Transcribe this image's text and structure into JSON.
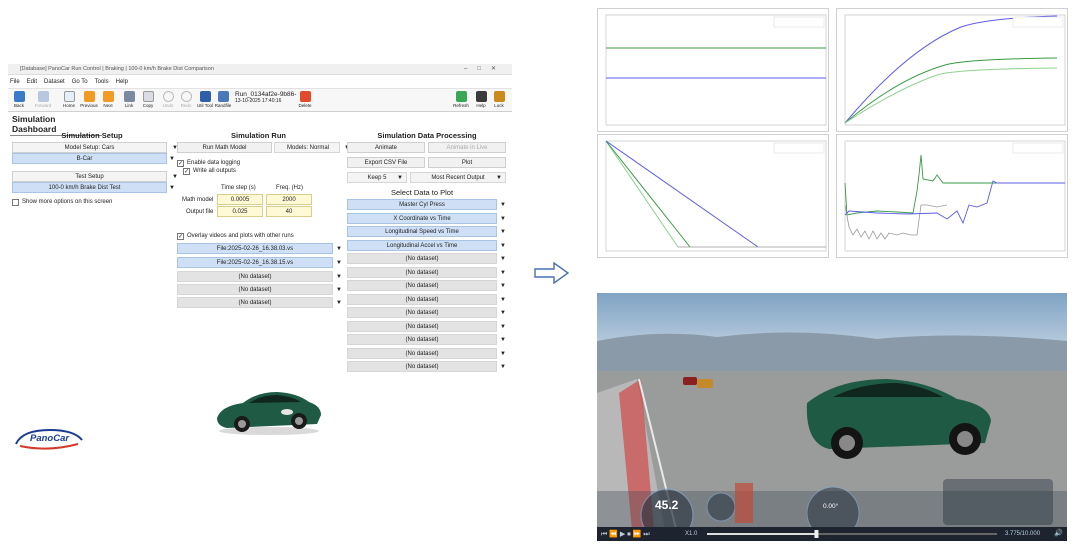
{
  "window": {
    "title": "[Database] PanoCar Run Control | Braking | 100-0 km/h Brake Dist Comparison",
    "menu": [
      "File",
      "Edit",
      "Dataset",
      "Go To",
      "Tools",
      "Help"
    ],
    "toolbar": {
      "back": "Back",
      "forward": "Forward",
      "home": "Home",
      "previous": "Previous",
      "next": "Next",
      "link": "Link",
      "copy": "Copy",
      "undo": "Undo",
      "redo": "Redo",
      "util_tool": "Util Tool",
      "randfile": "Randfile",
      "delete": "Delete",
      "refresh": "Refresh",
      "help": "Help",
      "lock": "Lock"
    },
    "run_name": "Run_0134af2e-9b86-",
    "run_time": "13-10-2025 17:40:16"
  },
  "dashboard": {
    "title": "Simulation Dashboard",
    "setup": {
      "heading": "Simulation Setup",
      "model_setup": "Model Setup: Cars",
      "vehicle": "B-Car",
      "test_setup": "Test Setup",
      "test": "100-0 km/h Brake Dist Test",
      "more_options": "Show more options on this screen"
    },
    "run": {
      "heading": "Simulation Run",
      "run_math": "Run Math Model",
      "models": "Models: Normal",
      "enable_logging": "Enable data logging",
      "write_outputs": "Write all outputs",
      "col_timestep": "Time step (s)",
      "col_freq": "Freq. (Hz)",
      "math_model_label": "Math model",
      "math_timestep": "0.0005",
      "math_freq": "2000",
      "output_file_label": "Output file",
      "output_timestep": "0.025",
      "output_freq": "40",
      "overlay": "Overlay videos and plots with other runs",
      "overlay_files": [
        "File:2025-02-26_16.38.03.vs",
        "File:2025-02-26_16.38.15.vs",
        "(No dataset)",
        "(No dataset)",
        "(No dataset)"
      ]
    },
    "processing": {
      "heading": "Simulation Data Processing",
      "animate": "Animate",
      "animate_live": "Animate in Live",
      "export_csv": "Export CSV File",
      "plot": "Plot",
      "keep": "Keep 5",
      "recent": "Most Recent Output",
      "select_heading": "Select Data to Plot",
      "plot_items": [
        "Master Cyl Press",
        "X Coordinate vs Time",
        "Longitudinal Speed vs Time",
        "Longitudinal Accel vs Time",
        "(No dataset)",
        "(No dataset)",
        "(No dataset)",
        "(No dataset)",
        "(No dataset)",
        "(No dataset)",
        "(No dataset)",
        "(No dataset)",
        "(No dataset)"
      ]
    },
    "logo": "PanoCar"
  },
  "simulation_view": {
    "speed": "45.2",
    "steer_angle": "0.00°",
    "playback_speed": "X1.0",
    "time": "3.775/10.000",
    "progress": 0.3775
  },
  "colors": {
    "selection_blue": "#cfe0f6",
    "series_blue": "#5b5ce8",
    "series_green_dark": "#3a9a45",
    "series_green_light": "#8fd08f",
    "car_green": "#1f5a44"
  }
}
